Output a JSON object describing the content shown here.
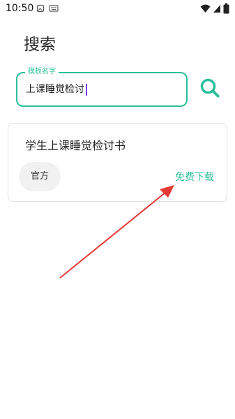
{
  "status_bar": {
    "time": "10:50",
    "icons": [
      "image-icon",
      "keyboard-icon",
      "wifi-icon",
      "signal-icon",
      "battery-icon"
    ]
  },
  "page": {
    "title": "搜索"
  },
  "search": {
    "label": "模板名字",
    "value": "上课睡觉检讨",
    "button_icon": "search-icon"
  },
  "results": [
    {
      "title": "学生上课睡觉检讨书",
      "tag": "官方",
      "action_label": "免费下载"
    }
  ],
  "colors": {
    "accent": "#2bbf9a",
    "cursor": "#7a3cf2",
    "annotation_arrow": "#e53935"
  }
}
